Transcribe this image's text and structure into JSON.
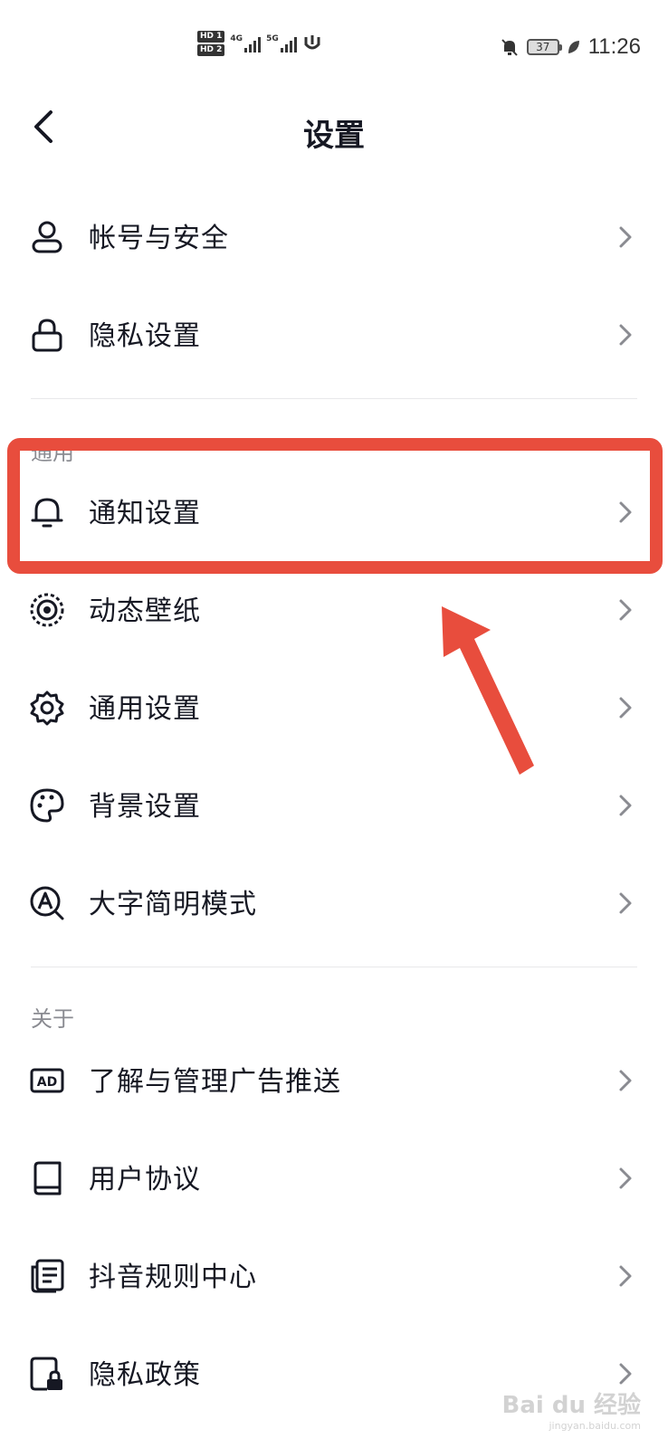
{
  "status_bar": {
    "hd1": "HD 1",
    "hd2": "HD 2",
    "net1": "4G",
    "net2": "5G",
    "battery": "37",
    "time": "11:26"
  },
  "header": {
    "title": "设置"
  },
  "sections": {
    "general": "通用",
    "about": "关于"
  },
  "rows": [
    {
      "label": "帐号与安全",
      "icon": "user-icon"
    },
    {
      "label": "隐私设置",
      "icon": "lock-icon"
    },
    {
      "label": "通知设置",
      "icon": "bell-icon"
    },
    {
      "label": "动态壁纸",
      "icon": "live-wallpaper-icon"
    },
    {
      "label": "通用设置",
      "icon": "gear-icon"
    },
    {
      "label": "背景设置",
      "icon": "palette-icon"
    },
    {
      "label": "大字简明模式",
      "icon": "large-text-icon"
    },
    {
      "label": "了解与管理广告推送",
      "icon": "ad-icon"
    },
    {
      "label": "用户协议",
      "icon": "book-icon"
    },
    {
      "label": "抖音规则中心",
      "icon": "document-icon"
    },
    {
      "label": "隐私政策",
      "icon": "privacy-doc-icon"
    }
  ],
  "watermark": {
    "brand": "Bai du 经验",
    "url": "jingyan.baidu.com"
  },
  "colors": {
    "annotation": "#e84d3d",
    "text": "#161823",
    "secondary": "#8a8b91"
  }
}
